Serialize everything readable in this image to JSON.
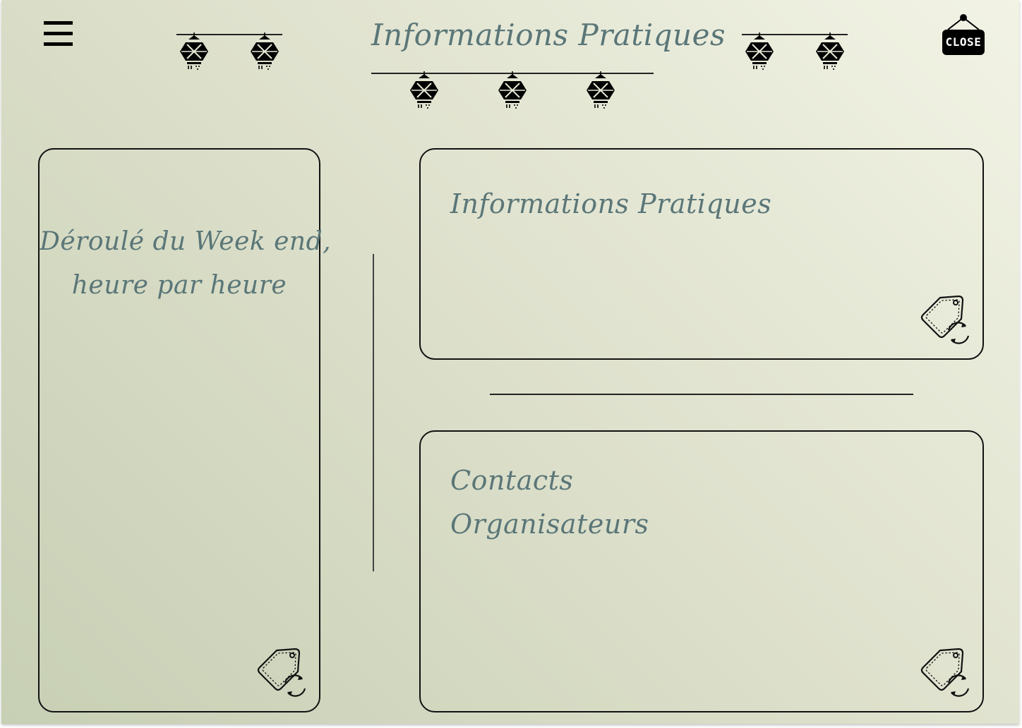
{
  "header": {
    "title": "Informations Pratiques",
    "menu_icon": "hamburger-menu-icon",
    "close_label": "CLOSE"
  },
  "decor": {
    "lantern_icon": "lantern-icon"
  },
  "panels": {
    "schedule": {
      "title_line1": "Déroulé du Week end,",
      "title_line2": "heure par heure",
      "action_icon": "tag-refresh-icon"
    },
    "info": {
      "title": "Informations Pratiques",
      "action_icon": "tag-refresh-icon"
    },
    "contacts": {
      "title_line1": "Contacts",
      "title_line2": "Organisateurs",
      "action_icon": "tag-refresh-icon"
    }
  },
  "colors": {
    "accent_text": "#5a7678",
    "outline": "#111111"
  }
}
